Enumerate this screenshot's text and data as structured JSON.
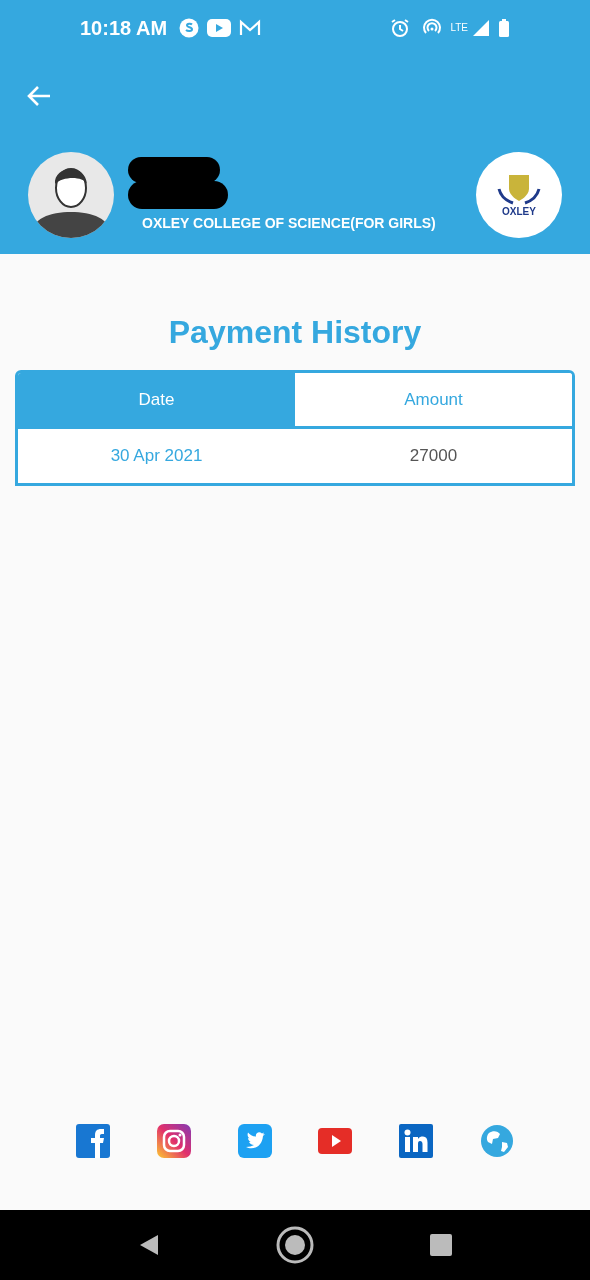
{
  "status_bar": {
    "time": "10:18 AM",
    "network": "LTE"
  },
  "header": {
    "school": "OXLEY COLLEGE OF SCIENCE(FOR GIRLS)",
    "logo_text": "OXLEY"
  },
  "title": "Payment History",
  "table": {
    "columns": [
      {
        "label": "Date",
        "selected": true
      },
      {
        "label": "Amount",
        "selected": false
      }
    ],
    "rows": [
      [
        "30 Apr 2021",
        "27000"
      ]
    ]
  },
  "social": [
    {
      "kind": "facebook"
    },
    {
      "kind": "instagram"
    },
    {
      "kind": "twitter"
    },
    {
      "kind": "youtube"
    },
    {
      "kind": "linkedin"
    },
    {
      "kind": "website"
    }
  ]
}
